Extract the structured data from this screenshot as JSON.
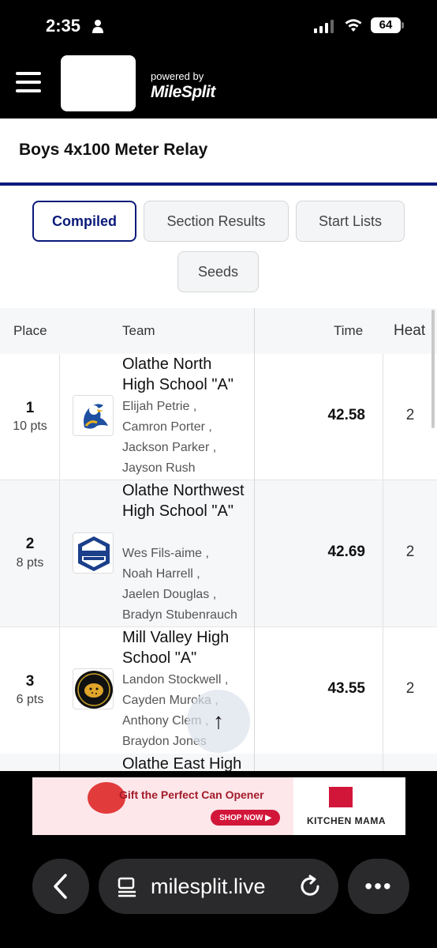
{
  "status_bar": {
    "time": "2:35",
    "battery": "64"
  },
  "header": {
    "powered_by": "powered by",
    "brand": "MileSplit"
  },
  "event": {
    "title": "Boys 4x100 Meter Relay"
  },
  "tabs": [
    {
      "label": "Compiled",
      "active": true
    },
    {
      "label": "Section Results",
      "active": false
    },
    {
      "label": "Start Lists",
      "active": false
    },
    {
      "label": "Seeds",
      "active": false
    }
  ],
  "table": {
    "headers": {
      "place": "Place",
      "team": "Team",
      "time": "Time",
      "heat": "Heat"
    },
    "rows": [
      {
        "place": "1",
        "points": "10 pts",
        "team": "Olathe North High School \"A\"",
        "athletes": [
          "Elijah Petrie ,",
          "Camron Porter ,",
          "Jackson Parker ,",
          "Jayson Rush"
        ],
        "time": "42.58",
        "heat": "2",
        "logo": "eagle-logo"
      },
      {
        "place": "2",
        "points": "8 pts",
        "team": "Olathe Northwest High School \"A\"",
        "athletes": [
          "Wes Fils-aime ,",
          "Noah Harrell ,",
          "Jaelen Douglas ,",
          "Bradyn Stubenrauch"
        ],
        "time": "42.69",
        "heat": "2",
        "logo": "northwest-track-logo"
      },
      {
        "place": "3",
        "points": "6 pts",
        "team": "Mill Valley High School \"A\"",
        "athletes": [
          "Landon Stockwell ,",
          "Cayden Muroka ,",
          "Anthony Clem ,",
          "Braydon Jones"
        ],
        "time": "43.55",
        "heat": "2",
        "logo": "jaguars-logo"
      },
      {
        "team": "Olathe East High"
      }
    ]
  },
  "ad": {
    "headline": "Gift the Perfect Can Opener",
    "cta": "SHOP NOW ▶",
    "brand": "KITCHEN MAMA"
  },
  "browser": {
    "url": "milesplit.live"
  },
  "colors": {
    "accent": "#0a1a7a",
    "header_bg": "#000000",
    "row_alt": "#f6f7f9"
  }
}
